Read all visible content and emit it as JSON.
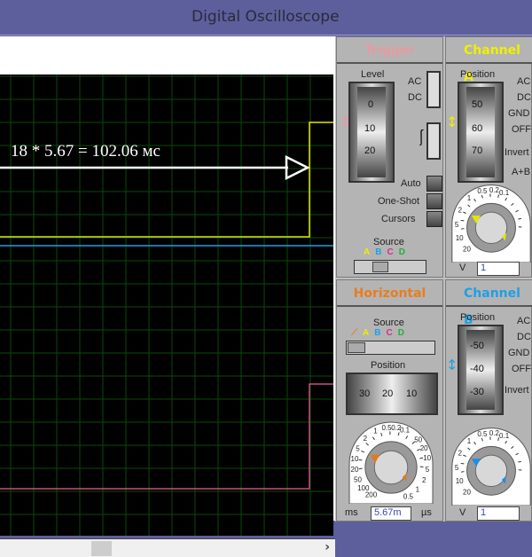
{
  "window": {
    "title": "Digital Oscilloscope"
  },
  "screen": {
    "annotation": "18 * 5.67 = 102.06 мс",
    "colors": {
      "grid": "#0a4a0a",
      "channel_a": "#e6e600",
      "channel_b": "#1ea0e6",
      "channel_c": "#c8507a",
      "annotation": "#ffffff"
    }
  },
  "trigger": {
    "title": "Trigger",
    "level_label": "Level",
    "level_ticks": [
      "0",
      "10",
      "20"
    ],
    "coupling": [
      "AC",
      "DC"
    ],
    "buttons": [
      "Auto",
      "One-Shot",
      "Cursors"
    ],
    "source_label": "Source",
    "sources": [
      "A",
      "B",
      "C",
      "D"
    ]
  },
  "channel_a": {
    "title": "Channel A",
    "position_label": "Position",
    "position_ticks": [
      "50",
      "60",
      "70"
    ],
    "coupling": [
      "AC",
      "DC",
      "GND",
      "OFF"
    ],
    "invert": "Invert",
    "aplusb": "A+B",
    "dial": [
      "0.5",
      "0.2",
      "0.1",
      "1",
      "2",
      "5",
      "10",
      "20"
    ],
    "unit": "V",
    "value": "1"
  },
  "horizontal": {
    "title": "Horizontal",
    "source_label": "Source",
    "sources": [
      "A",
      "B",
      "C",
      "D"
    ],
    "position_label": "Position",
    "position_ticks": [
      "30",
      "20",
      "10"
    ],
    "dial_left": [
      "1",
      "0.5",
      "0.2",
      "0.1",
      "2",
      "5",
      "10",
      "20",
      "50",
      "100",
      "200"
    ],
    "dial_right": [
      "50",
      "20",
      "10",
      "5",
      "2",
      "1",
      "0.5"
    ],
    "unit_left": "ms",
    "unit_right": "µs",
    "value": "5.67m"
  },
  "channel_b": {
    "title": "Channel B",
    "position_label": "Position",
    "position_ticks": [
      "-50",
      "-40",
      "-30"
    ],
    "coupling": [
      "AC",
      "DC",
      "GND",
      "OFF"
    ],
    "invert": "Invert",
    "dial": [
      "0.5",
      "0.2",
      "0.1",
      "1",
      "2",
      "5",
      "10",
      "20"
    ],
    "unit": "V",
    "value": "1"
  }
}
